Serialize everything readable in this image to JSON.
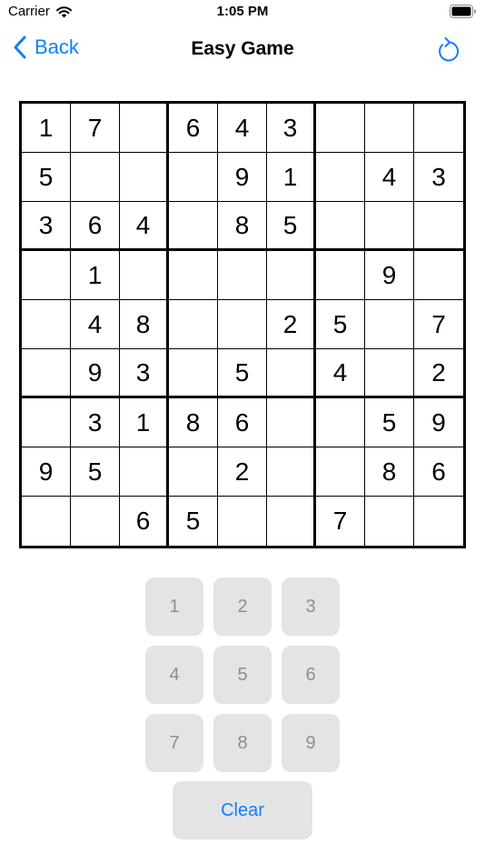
{
  "status_bar": {
    "carrier": "Carrier",
    "time": "1:05 PM"
  },
  "nav": {
    "back_label": "Back",
    "title": "Easy Game",
    "refresh_icon": "refresh-icon"
  },
  "colors": {
    "accent": "#147efb",
    "key_background": "#e4e4e5",
    "key_text": "#8e8e93"
  },
  "board": [
    [
      "1",
      "7",
      "",
      "6",
      "4",
      "3",
      "",
      "",
      ""
    ],
    [
      "5",
      "",
      "",
      "",
      "9",
      "1",
      "",
      "4",
      "3"
    ],
    [
      "3",
      "6",
      "4",
      "",
      "8",
      "5",
      "",
      "",
      ""
    ],
    [
      "",
      "1",
      "",
      "",
      "",
      "",
      "",
      "9",
      ""
    ],
    [
      "",
      "4",
      "8",
      "",
      "",
      "2",
      "5",
      "",
      "7"
    ],
    [
      "",
      "9",
      "3",
      "",
      "5",
      "",
      "4",
      "",
      "2"
    ],
    [
      "",
      "3",
      "1",
      "8",
      "6",
      "",
      "",
      "5",
      "9"
    ],
    [
      "9",
      "5",
      "",
      "",
      "2",
      "",
      "",
      "8",
      "6"
    ],
    [
      "",
      "",
      "6",
      "5",
      "",
      "",
      "7",
      "",
      ""
    ]
  ],
  "numpad": {
    "keys": [
      "1",
      "2",
      "3",
      "4",
      "5",
      "6",
      "7",
      "8",
      "9"
    ],
    "clear_label": "Clear"
  }
}
